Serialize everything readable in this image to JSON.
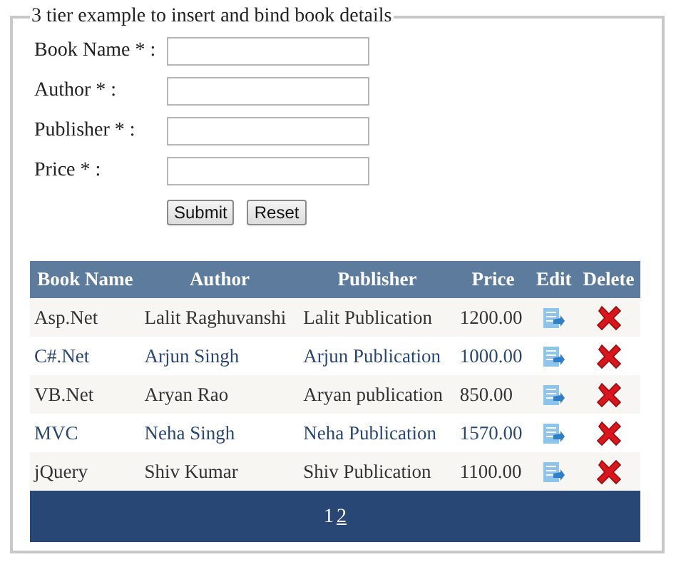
{
  "legend": "3 tier example to insert and bind book details",
  "form": {
    "fields": [
      {
        "label": "Book Name * :"
      },
      {
        "label": "Author * :"
      },
      {
        "label": "Publisher * :"
      },
      {
        "label": "Price * :"
      }
    ],
    "buttons": [
      "Submit",
      "Reset"
    ]
  },
  "table": {
    "columns": [
      "Book Name",
      "Author",
      "Publisher",
      "Price",
      "Edit",
      "Delete"
    ],
    "rows": [
      {
        "cells": [
          "Asp.Net",
          "Lalit Raghuvanshi",
          "Lalit Publication",
          "1200.00"
        ]
      },
      {
        "cells": [
          "C#.Net",
          "Arjun Singh",
          "Arjun Publication",
          "1000.00"
        ]
      },
      {
        "cells": [
          "VB.Net",
          "Aryan Rao",
          "Aryan publication",
          "850.00"
        ]
      },
      {
        "cells": [
          "MVC",
          "Neha Singh",
          "Neha Publication",
          "1570.00"
        ]
      },
      {
        "cells": [
          "jQuery",
          "Shiv Kumar",
          "Shiv Publication",
          "1100.00"
        ]
      }
    ],
    "pager": [
      {
        "label": "1",
        "selected": true
      },
      {
        "label": "2",
        "selected": false
      }
    ]
  }
}
